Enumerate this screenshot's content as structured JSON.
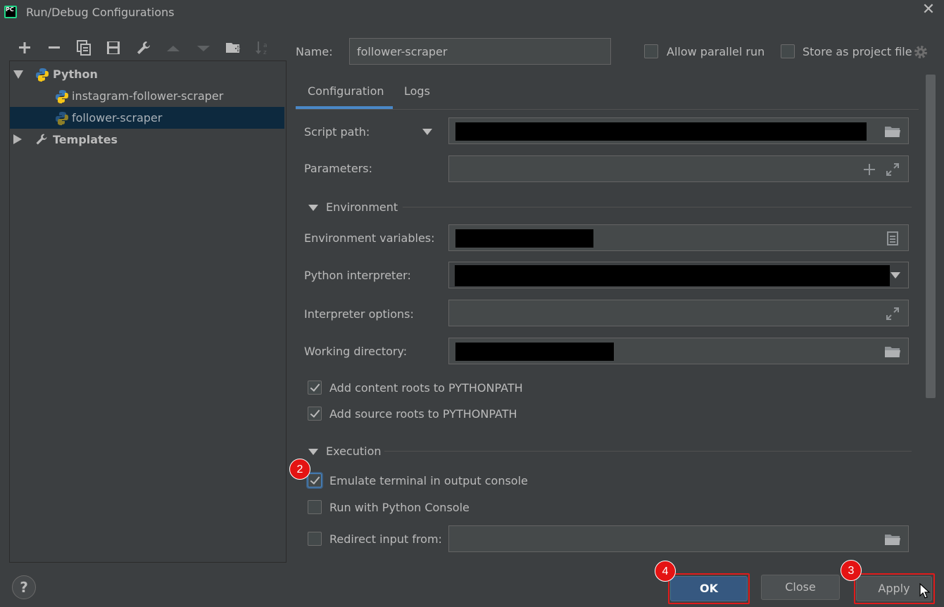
{
  "window": {
    "title": "Run/Debug Configurations",
    "app_icon_text": "PC"
  },
  "toolbar": {
    "icons": [
      "add-icon",
      "remove-icon",
      "copy-icon",
      "save-icon",
      "wrench-icon",
      "move-up-icon",
      "move-down-icon",
      "new-folder-icon",
      "sort-alpha-icon"
    ]
  },
  "tree": {
    "python": "Python",
    "items": [
      "instagram-follower-scraper",
      "follower-scraper"
    ],
    "templates": "Templates"
  },
  "header": {
    "name_label": "Name:",
    "name_value": "follower-scraper",
    "allow_parallel": "Allow parallel run",
    "store_project": "Store as project file"
  },
  "tabs": [
    "Configuration",
    "Logs"
  ],
  "form": {
    "script_path": "Script path:",
    "parameters": "Parameters:",
    "environment": "Environment",
    "env_vars": "Environment variables:",
    "python_interpreter": "Python interpreter:",
    "interpreter_options": "Interpreter options:",
    "working_directory": "Working directory:",
    "add_content_roots": "Add content roots to PYTHONPATH",
    "add_source_roots": "Add source roots to PYTHONPATH",
    "execution": "Execution",
    "emulate_terminal": "Emulate terminal in output console",
    "run_python_console": "Run with Python Console",
    "redirect_input": "Redirect input from:"
  },
  "checks": {
    "allow_parallel": false,
    "store_project": false,
    "add_content_roots": true,
    "add_source_roots": true,
    "emulate_terminal": true,
    "run_python_console": false,
    "redirect_input": false
  },
  "buttons": {
    "ok": "OK",
    "close": "Close",
    "apply": "Apply",
    "help": "?"
  },
  "annotations": {
    "emulate_badge": "2",
    "apply_badge": "3",
    "ok_badge": "4"
  },
  "colors": {
    "accent": "#4a88c7",
    "selection": "#0d293e",
    "primary_button": "#365880",
    "annotation_red": "#e41313"
  }
}
